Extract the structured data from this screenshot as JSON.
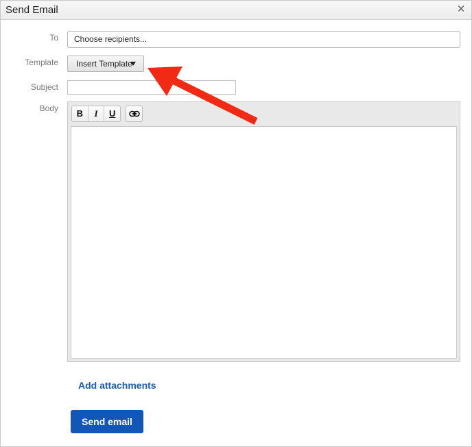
{
  "dialog": {
    "title": "Send Email",
    "close_symbol": "×"
  },
  "form": {
    "to_label": "To",
    "to_value": "Choose recipients...",
    "template_label": "Template",
    "template_button": "Insert Template",
    "subject_label": "Subject",
    "subject_value": "",
    "body_label": "Body"
  },
  "toolbar": {
    "bold": "B",
    "italic": "I",
    "underline": "U",
    "link_icon": "link-icon"
  },
  "actions": {
    "add_attachments": "Add attachments",
    "send": "Send email"
  },
  "annotation": {
    "arrow_color": "#f02a14"
  },
  "colors": {
    "primary_button": "#1257b8",
    "link": "#1a5bb5"
  }
}
